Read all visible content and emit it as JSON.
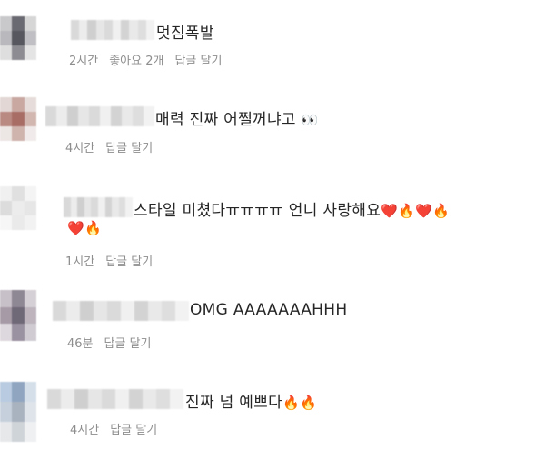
{
  "comments": [
    {
      "text": "멋짐폭발",
      "emoji": "",
      "time": "2시간",
      "likes": "좋아요 2개",
      "reply": "답글 달기",
      "avatar_colors": [
        "#c9c9cc",
        "#6a6a72",
        "#d6d6d6",
        "#b8b8bd",
        "#57575f",
        "#c0c0c4",
        "#dedede",
        "#8c8c92",
        "#e4e4e4"
      ]
    },
    {
      "text": "매력 진짜 어쩔꺼냐고",
      "emoji": "👀",
      "time": "4시간",
      "likes": "",
      "reply": "답글 달기",
      "avatar_colors": [
        "#e2d7d4",
        "#c9a8a2",
        "#e6dcd9",
        "#b98a82",
        "#a86e66",
        "#d2b6b0",
        "#ece6e4",
        "#cfb3ad",
        "#f0ebea"
      ]
    },
    {
      "text": "스타일 미쳤다ㅠㅠㅠㅠ 언니 사랑해요",
      "emoji": "❤️🔥❤️🔥",
      "emoji_line2": "❤️🔥",
      "time": "1시간",
      "likes": "",
      "reply": "답글 달기",
      "avatar_colors": [
        "#f0f0f0",
        "#e0e0e0",
        "#f4f4f4",
        "#dcdcdc",
        "#ececec",
        "#e6e6e6",
        "#f6f6f6",
        "#eaeaea",
        "#f2f2f2"
      ]
    },
    {
      "text": "OMG AAAAAAAHHH",
      "emoji": "",
      "time": "46분",
      "likes": "",
      "reply": "답글 달기",
      "avatar_colors": [
        "#c7c0c8",
        "#8e8794",
        "#d5d0d6",
        "#a69aa6",
        "#6f6877",
        "#bdb4be",
        "#dcd8dd",
        "#9a92a0",
        "#d0cbd2"
      ]
    },
    {
      "text": "진짜 넘 예쁘다",
      "emoji": "🔥🔥",
      "time": "4시간",
      "likes": "",
      "reply": "답글 달기",
      "avatar_colors": [
        "#b9cbe0",
        "#8fa5c0",
        "#d5dfea",
        "#c6d0dc",
        "#a9b3bf",
        "#dfe4ea",
        "#e6e8ea",
        "#cfd4d8",
        "#eef0f2"
      ]
    }
  ],
  "name_blur_colors": [
    "#d9d9d9",
    "#ececec",
    "#cfcfcf",
    "#e6e6e6",
    "#dadada",
    "#f0f0f0",
    "#d3d3d3",
    "#e9e9e9",
    "#dedede",
    "#f2f2f2"
  ]
}
